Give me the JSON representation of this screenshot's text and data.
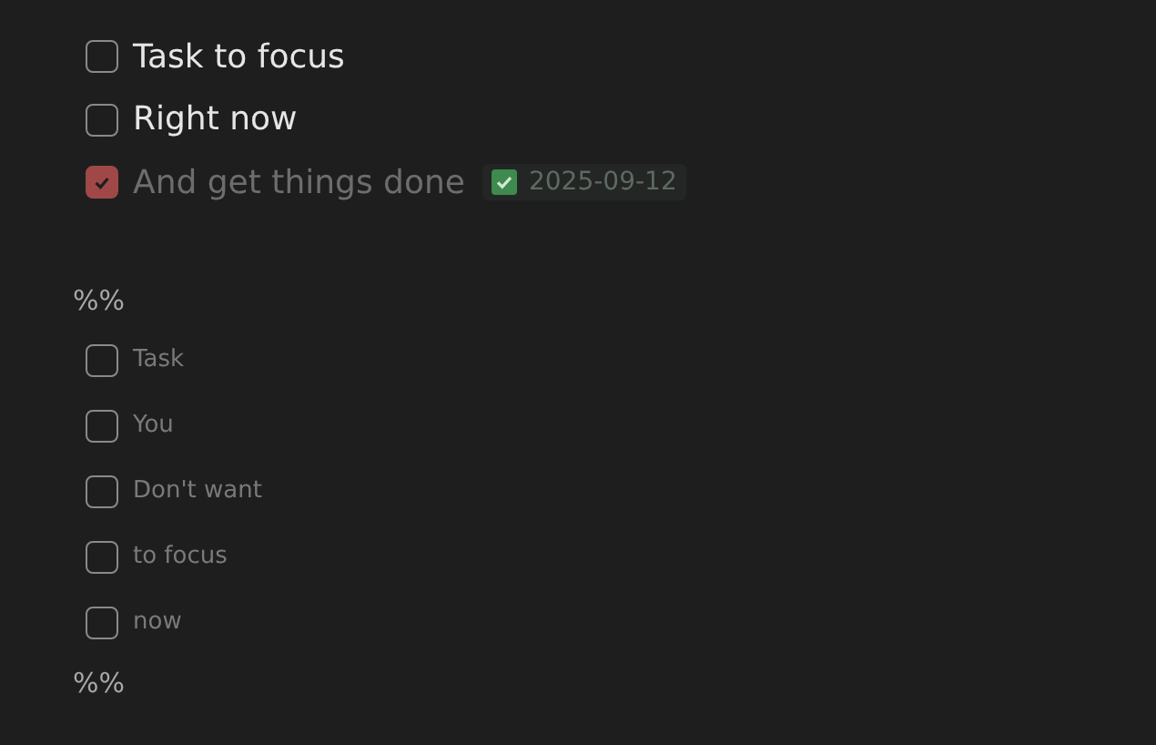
{
  "tasks": [
    {
      "text": "Task to focus",
      "checked": false
    },
    {
      "text": "Right now",
      "checked": false
    },
    {
      "text": "And get things done",
      "checked": true,
      "done_date": "2025-09-12"
    }
  ],
  "comment_block": {
    "open_marker": "%%",
    "close_marker": "%%",
    "tasks": [
      {
        "text": "Task",
        "checked": false,
        "faded": true
      },
      {
        "text": "You",
        "checked": false,
        "faded": true
      },
      {
        "text": "Don't want",
        "checked": false,
        "faded": true
      },
      {
        "text": "to focus",
        "checked": false,
        "faded": true
      },
      {
        "text": "now",
        "checked": false,
        "faded": true
      }
    ]
  }
}
